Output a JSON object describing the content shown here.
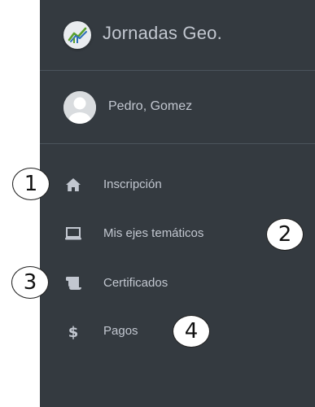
{
  "brand": {
    "title": "Jornadas Geo.",
    "logo_icon": "line-chart-icon"
  },
  "user": {
    "name": "Pedro, Gomez",
    "avatar_icon": "user-avatar-icon"
  },
  "nav": {
    "items": [
      {
        "label": "Inscripción",
        "icon": "home-icon"
      },
      {
        "label": "Mis ejes temáticos",
        "icon": "laptop-icon"
      },
      {
        "label": "Certificados",
        "icon": "scroll-icon"
      },
      {
        "label": "Pagos",
        "icon": "dollar-icon"
      }
    ]
  },
  "annotations": [
    "1",
    "2",
    "3",
    "4"
  ],
  "colors": {
    "sidebar_bg": "#343a40",
    "text": "#c2c7d0",
    "divider": "#4b545c"
  }
}
